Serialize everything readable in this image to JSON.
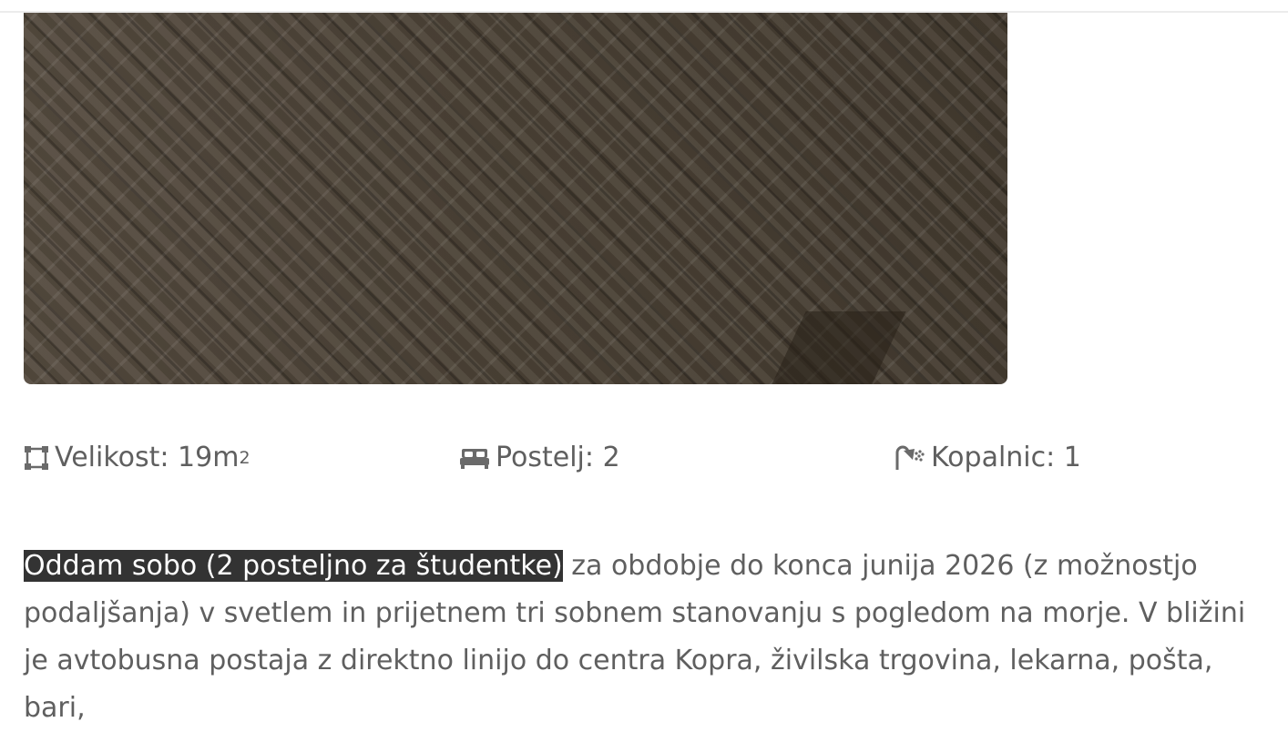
{
  "listing": {
    "photo": {
      "alt": "wooden parquet floor"
    },
    "features": {
      "size": {
        "label": "Velikost:",
        "value": "19m",
        "unit_sup": "2",
        "icon": "area-icon"
      },
      "beds": {
        "label": "Postelj:",
        "value": "2",
        "icon": "bed-icon"
      },
      "baths": {
        "label": "Kopalnic:",
        "value": "1",
        "icon": "shower-icon"
      }
    },
    "description": {
      "highlighted": "Oddam sobo (2 posteljno za študentke)",
      "rest": " za obdobje do konca junija 2026 (z možnostjo podaljšanja) v svetlem in prijetnem tri sobnem stanovanju s pogledom na morje. V bližini je avtobusna postaja z direktno linijo do centra Kopra, živilska trgovina, lekarna, pošta, bari,"
    }
  },
  "colors": {
    "text": "#5f5f5f",
    "highlight_bg": "#333333",
    "highlight_text": "#ffffff"
  }
}
